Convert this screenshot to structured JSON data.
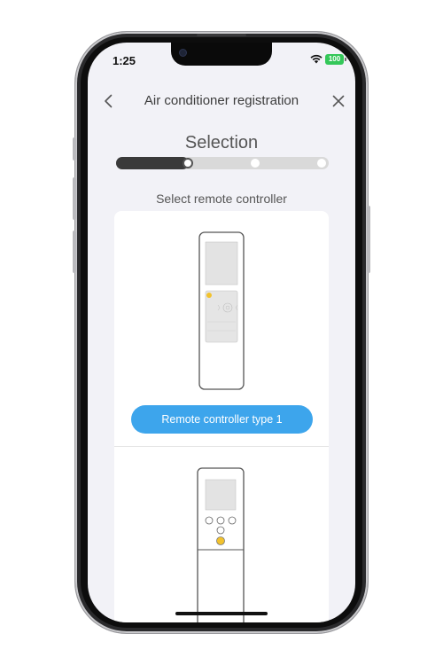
{
  "status_bar": {
    "time": "1:25",
    "battery": "100",
    "battery_color": "#34c759"
  },
  "nav": {
    "title": "Air conditioner registration",
    "back_icon": "chevron-left-icon",
    "close_icon": "close-icon"
  },
  "step": {
    "title": "Selection",
    "progress_fraction": 0.34,
    "total_steps": 3,
    "current_step": 1
  },
  "section": {
    "label": "Select remote controller"
  },
  "options": [
    {
      "label": "Remote controller type 1",
      "image": "remote-controller-type-1-image"
    },
    {
      "label": "",
      "image": "remote-controller-type-2-image"
    }
  ],
  "colors": {
    "accent": "#3da5ec",
    "progress_fill": "#3a3a3a",
    "background": "#f2f2f7"
  }
}
